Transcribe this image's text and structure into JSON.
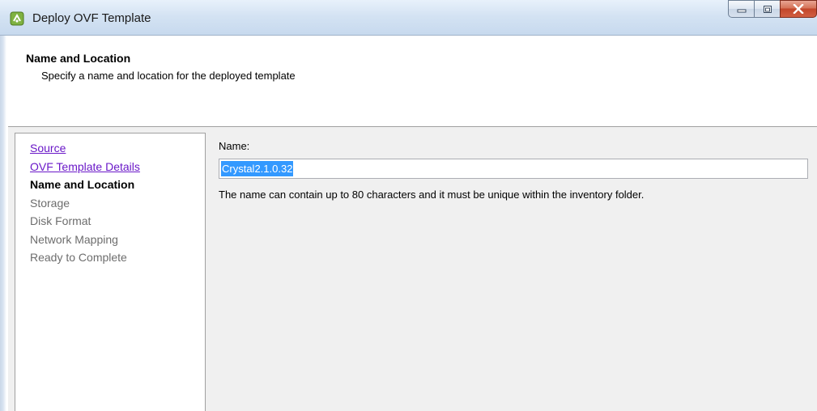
{
  "window": {
    "title": "Deploy OVF Template",
    "icon": "vmware-vsphere-icon"
  },
  "caption_buttons": {
    "minimize_icon": "minimize-icon",
    "maximize_icon": "maximize-icon",
    "close_label": "X"
  },
  "header": {
    "title": "Name and Location",
    "subtitle": "Specify a name and location for the deployed template"
  },
  "nav": {
    "items": [
      {
        "label": "Source",
        "state": "visited"
      },
      {
        "label": "OVF Template Details",
        "state": "visited"
      },
      {
        "label": "Name and Location",
        "state": "current"
      },
      {
        "label": "Storage",
        "state": "future"
      },
      {
        "label": "Disk Format",
        "state": "future"
      },
      {
        "label": "Network Mapping",
        "state": "future"
      },
      {
        "label": "Ready to Complete",
        "state": "future"
      }
    ]
  },
  "form": {
    "name_label": "Name:",
    "name_value": "Crystal2.1.0.32",
    "hint": "The name can contain up to 80 characters and it must be unique within the inventory folder."
  },
  "colors": {
    "link": "#6a18c8",
    "selection": "#3399ff",
    "disabled_text": "#6d6d6d"
  }
}
